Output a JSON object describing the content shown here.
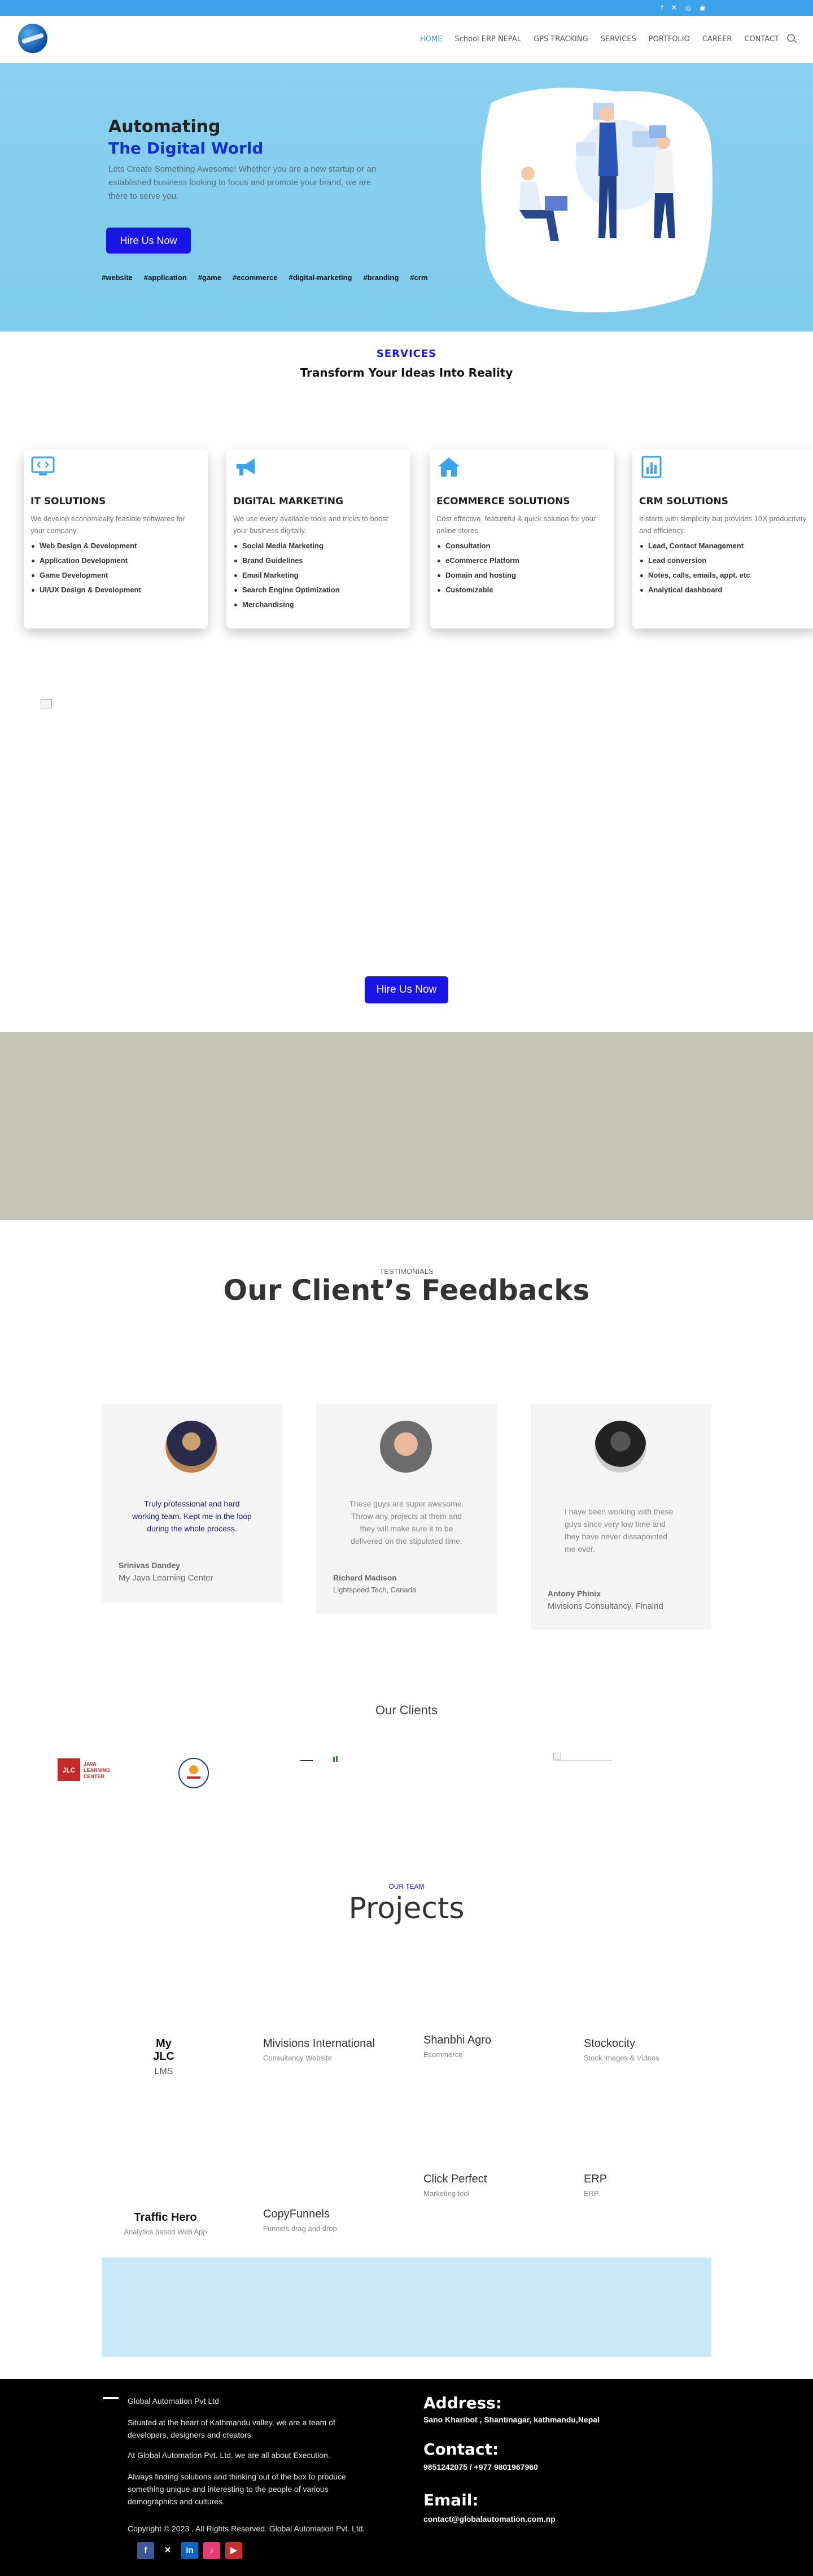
{
  "topbar": {
    "social_icons": [
      "facebook-icon",
      "x-icon",
      "instagram-icon",
      "rss-icon"
    ]
  },
  "nav": {
    "items": [
      "HOME",
      "School ERP NEPAL",
      "GPS TRACKING",
      "SERVICES",
      "PORTFOLIO",
      "CAREER",
      "CONTACT"
    ],
    "active": "HOME"
  },
  "hero": {
    "title": "Automating",
    "subtitle": "The Digital World",
    "text": "Lets Create Something Awesome! Whether you are a new startup or an established business looking to focus and promote your brand, we are there to serve you.",
    "cta": "Hire Us Now",
    "hashtags": [
      "#website",
      "#application",
      "#game",
      "#ecommerce",
      "#digital-marketing",
      "#branding",
      "#crm"
    ]
  },
  "services": {
    "label": "SERVICES",
    "title": "Transform Your Ideas Into Reality",
    "cards": [
      {
        "title": "IT SOLUTIONS",
        "desc": "We develop economically feasible softwares for your company.",
        "items": [
          "Web Design & Development",
          "Application Development",
          "Game Development",
          "UI/UX Design & Development"
        ]
      },
      {
        "title": "DIGITAL MARKETING",
        "desc": "We use every available tools and tricks to boost your business digitally.",
        "items": [
          "Social Media Marketing",
          "Brand Guidelines",
          "Email Marketing",
          "Search Engine Optimization",
          "Merchandising"
        ]
      },
      {
        "title": "ECOMMERCE SOLUTIONS",
        "desc": "Cost effective, featureful & quick solution for your online stores",
        "items": [
          "Consultation",
          "eCommerce Platform",
          "Domain and hosting",
          "Customizable"
        ]
      },
      {
        "title": "CRM SOLUTIONS",
        "desc": "It starts with simplicity but provides 10X productivity and efficiency.",
        "items": [
          "Lead, Contact Management",
          "Lead conversion",
          "Notes, calls, emails, appt. etc",
          "Analytical dashboard"
        ]
      }
    ]
  },
  "mid_cta": "Hire Us Now",
  "testimonials": {
    "label": "TESTIMONIALS",
    "title": "Our Client’s Feedbacks",
    "items": [
      {
        "quote": "Truly professional and hard working team. Kept me in the loop during the whole process.",
        "name": "Srinivas Dandey",
        "org": "My Java Learning Center"
      },
      {
        "quote": "These guys are super awesome. Throw any projects at them and they will make sure it to be delivered on the stipulated time.",
        "name": "Richard Madison",
        "org": "Lightspeed Tech, Canada"
      },
      {
        "quote": "I have been working with these guys since very low time and they have never dissapointed me ever.",
        "name": "Antony Phinix",
        "org": "Mivisions Consultancy, Finalnd"
      }
    ]
  },
  "clients": {
    "title": "Our Clients",
    "jlc_logo_text": "JAVA LEARNING CENTER"
  },
  "projects": {
    "label": "OUR TEAM",
    "title": "Projects",
    "items": [
      {
        "title": "My JLC",
        "sub": "LMS"
      },
      {
        "title": "Mivisions International",
        "sub": "Consultancy Website"
      },
      {
        "title": "Shanbhi Agro",
        "sub": "Ecommerce"
      },
      {
        "title": "Stockocity",
        "sub": "Stock images & Videos"
      },
      {
        "title": "Click Perfect",
        "sub": "Marketing tool"
      },
      {
        "title": "ERP",
        "sub": "ERP"
      },
      {
        "title": "Traffic Hero",
        "sub": "Analytics based Web App"
      },
      {
        "title": "CopyFunnels",
        "sub": "Funnels drag and drop"
      }
    ]
  },
  "footer": {
    "company": "Global Automation Pvt Ltd",
    "about1": "Situated at the heart of Kathmandu valley, we are a team of developers, designers and creators.",
    "about2": "At Global Automation Pvt. Ltd. we are all about Execution.",
    "about3": "Always finding solutions and thinking out of the box to produce something unique and interesting to the people of various demographics and cultures.",
    "copyright": "Copyright © 2023 , All Rights Reserved. Global Automation Pvt. Ltd.",
    "address_label": "Address:",
    "address": "Sano Kharibot , Shantinagar, kathmandu,Nepal",
    "contact_label": "Contact:",
    "contact": "9851242075 / +977 9801967960",
    "email_label": "Email:",
    "email": "contact@globalautomation.com.np",
    "social": [
      "facebook-icon",
      "x-icon",
      "linkedin-icon",
      "tiktok-icon",
      "youtube-icon"
    ]
  }
}
